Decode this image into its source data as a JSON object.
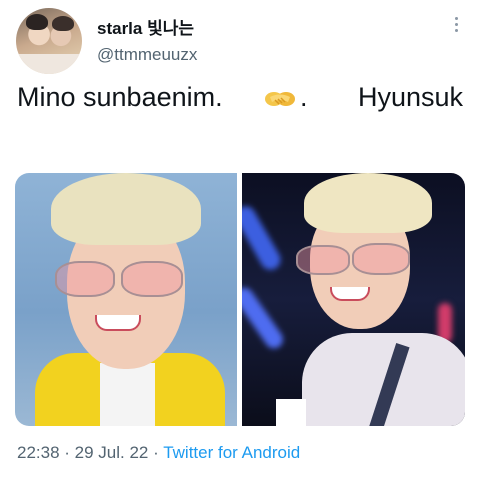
{
  "user": {
    "display_name": "starla 빛나는",
    "handle": "@ttmmeuuzx",
    "avatar_icon": "profile-photo"
  },
  "tweet": {
    "text_part1": "Mino sunbaenim.",
    "emoji_icon": "handshake-emoji",
    "text_dot": ".",
    "text_part2": "Hyunsuk"
  },
  "media": {
    "photos": [
      {
        "name": "photo-left",
        "description_icon": "portrait-photo"
      },
      {
        "name": "photo-right",
        "description_icon": "portrait-photo"
      }
    ]
  },
  "meta": {
    "time": "22:38",
    "separator1": " · ",
    "date": "29 Jul. 22",
    "separator2": " · ",
    "source": "Twitter for Android"
  },
  "colors": {
    "link": "#1d9bf0",
    "secondary_text": "#536471",
    "primary_text": "#0f1419"
  }
}
